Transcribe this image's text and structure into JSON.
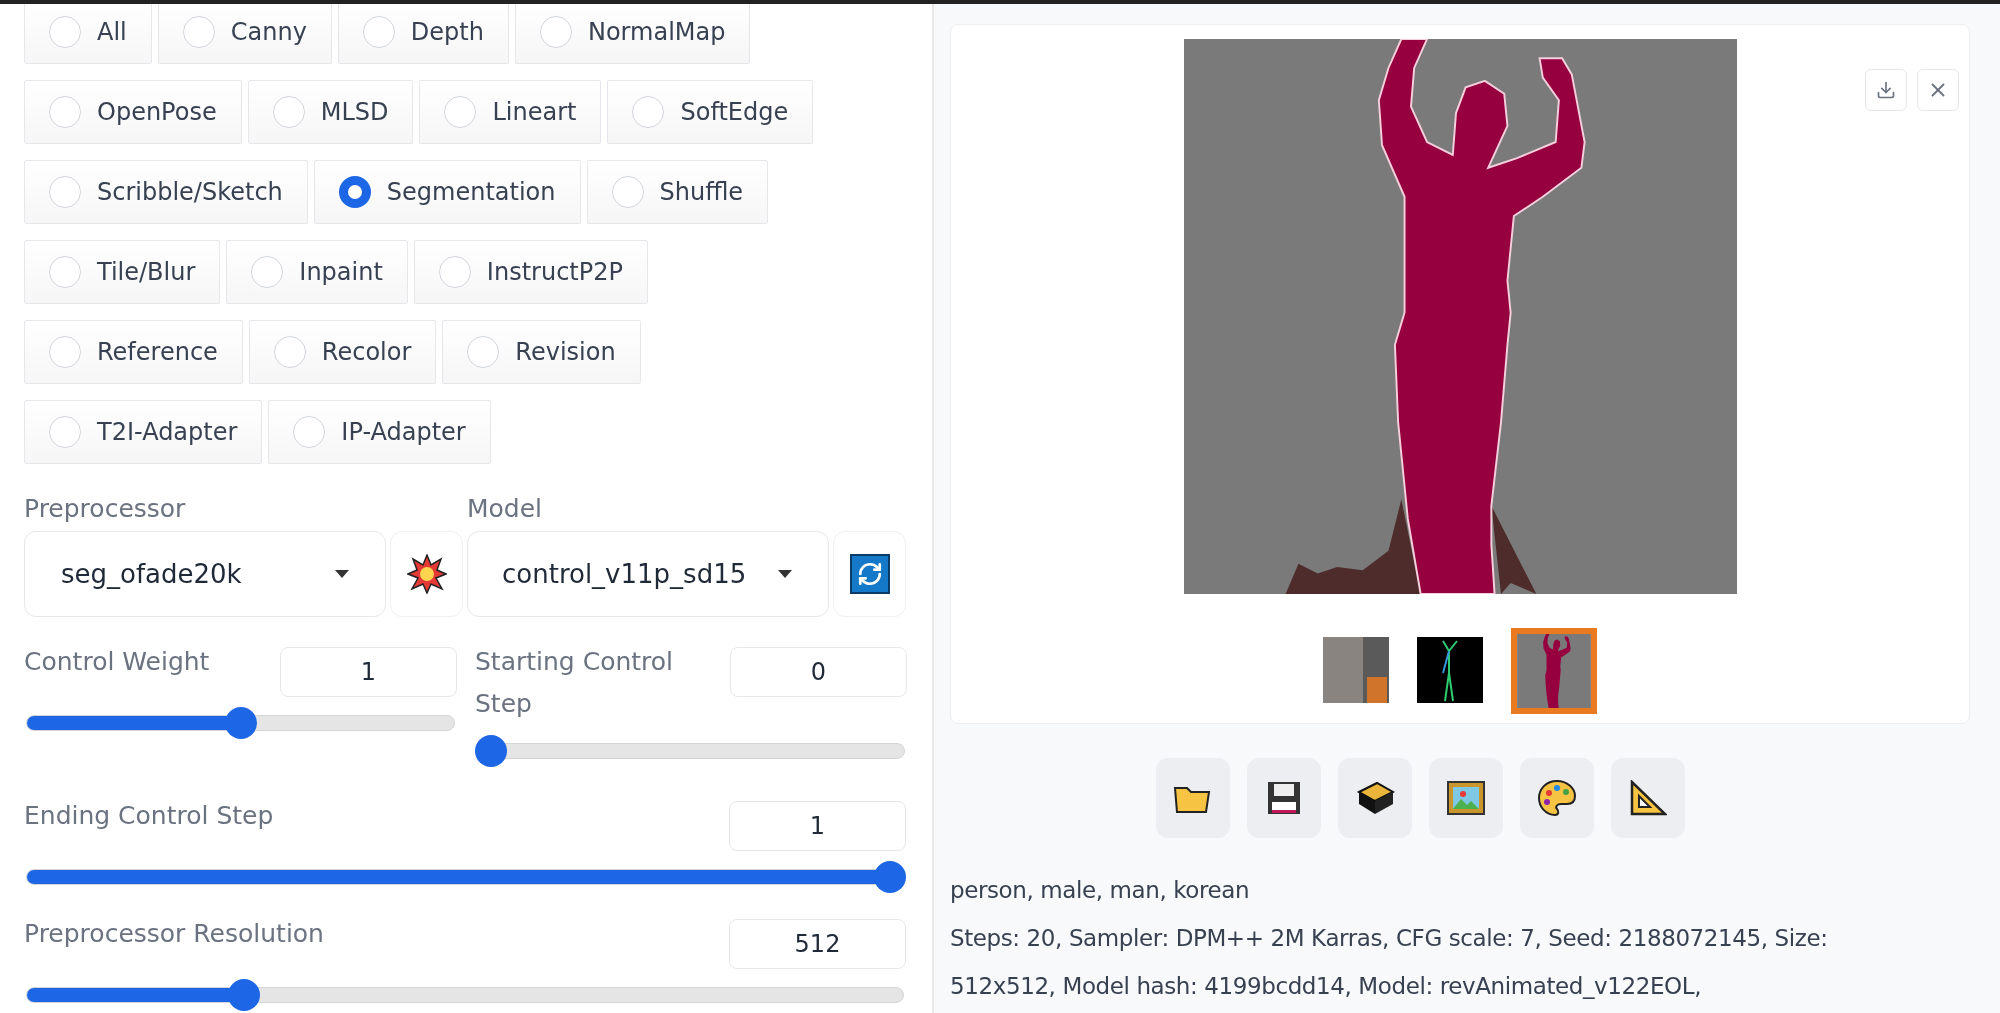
{
  "control_type_rows": [
    [
      {
        "label": "All",
        "selected": false
      },
      {
        "label": "Canny",
        "selected": false
      },
      {
        "label": "Depth",
        "selected": false
      },
      {
        "label": "NormalMap",
        "selected": false
      }
    ],
    [
      {
        "label": "OpenPose",
        "selected": false
      },
      {
        "label": "MLSD",
        "selected": false
      },
      {
        "label": "Lineart",
        "selected": false
      },
      {
        "label": "SoftEdge",
        "selected": false
      }
    ],
    [
      {
        "label": "Scribble/Sketch",
        "selected": false
      },
      {
        "label": "Segmentation",
        "selected": true
      },
      {
        "label": "Shuffle",
        "selected": false
      }
    ],
    [
      {
        "label": "Tile/Blur",
        "selected": false
      },
      {
        "label": "Inpaint",
        "selected": false
      },
      {
        "label": "InstructP2P",
        "selected": false
      }
    ],
    [
      {
        "label": "Reference",
        "selected": false
      },
      {
        "label": "Recolor",
        "selected": false
      },
      {
        "label": "Revision",
        "selected": false
      }
    ],
    [
      {
        "label": "T2I-Adapter",
        "selected": false
      },
      {
        "label": "IP-Adapter",
        "selected": false
      }
    ]
  ],
  "preprocessor": {
    "label": "Preprocessor",
    "value": "seg_ofade20k"
  },
  "model": {
    "label": "Model",
    "value": "control_v11p_sd15"
  },
  "sliders": [
    {
      "label": "Control Weight",
      "value": "1",
      "level": 0.5
    },
    {
      "label": "Starting Control Step",
      "value": "0",
      "level": 0
    },
    {
      "label": "Ending Control Step",
      "value": "1",
      "level": 1
    },
    {
      "label": "Preprocessor Resolution",
      "value": "512",
      "level": 0.24
    }
  ],
  "thumbnails": [
    {
      "kind": "photo",
      "selected": false
    },
    {
      "kind": "pose",
      "selected": false
    },
    {
      "kind": "segmentation",
      "selected": true
    }
  ],
  "tools": [
    {
      "kind": "folder"
    },
    {
      "kind": "save"
    },
    {
      "kind": "box"
    },
    {
      "kind": "picture"
    },
    {
      "kind": "palette"
    },
    {
      "kind": "ruler"
    }
  ],
  "info": [
    "person, male, man, korean",
    "Steps: 20, Sampler: DPM++ 2M Karras, CFG scale: 7, Seed: 2188072145, Size: 512x512, Model hash: 4199bcdd14, Model: revAnimated_v122EOL,"
  ]
}
